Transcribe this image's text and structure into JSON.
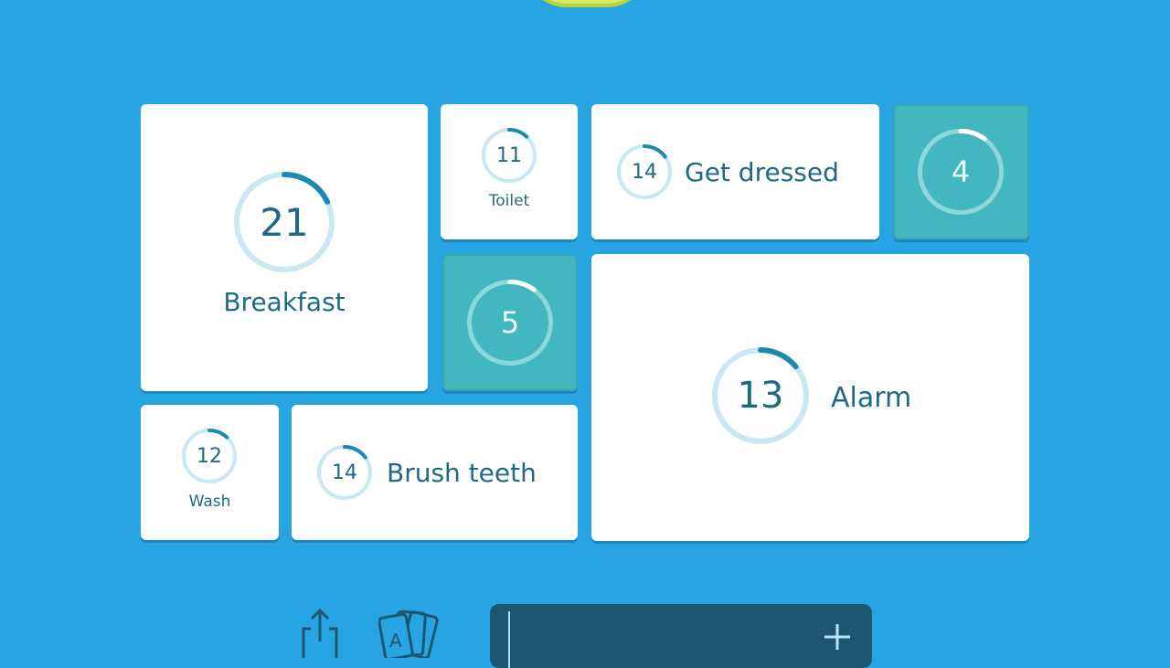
{
  "colors": {
    "background": "#27a4e2",
    "tile": "#ffffff",
    "tile_solved": "#43b7bf",
    "text": "#1e6a80",
    "ring_track": "#c9e8f2",
    "ring_progress": "#1c8ab0",
    "input_bg": "#1c5671"
  },
  "tiles": [
    {
      "name": "breakfast",
      "number": "21",
      "label": "Breakfast",
      "progress": 0.18,
      "solved": false
    },
    {
      "name": "toilet",
      "number": "11",
      "label": "Toilet",
      "progress": 0.12,
      "solved": false
    },
    {
      "name": "get-dressed",
      "number": "14",
      "label": "Get dressed",
      "progress": 0.15,
      "solved": false
    },
    {
      "name": "solved-4",
      "number": "4",
      "label": "",
      "progress": 0.1,
      "solved": true
    },
    {
      "name": "solved-5",
      "number": "5",
      "label": "",
      "progress": 0.1,
      "solved": true
    },
    {
      "name": "alarm",
      "number": "13",
      "label": "Alarm",
      "progress": 0.14,
      "solved": false
    },
    {
      "name": "wash",
      "number": "12",
      "label": "Wash",
      "progress": 0.12,
      "solved": false
    },
    {
      "name": "brush-teeth",
      "number": "14",
      "label": "Brush teeth",
      "progress": 0.15,
      "solved": false
    }
  ],
  "bottom": {
    "share_icon": "share-icon",
    "cards_icon": "cards-icon",
    "input_value": "",
    "plus_icon": "plus-icon"
  }
}
